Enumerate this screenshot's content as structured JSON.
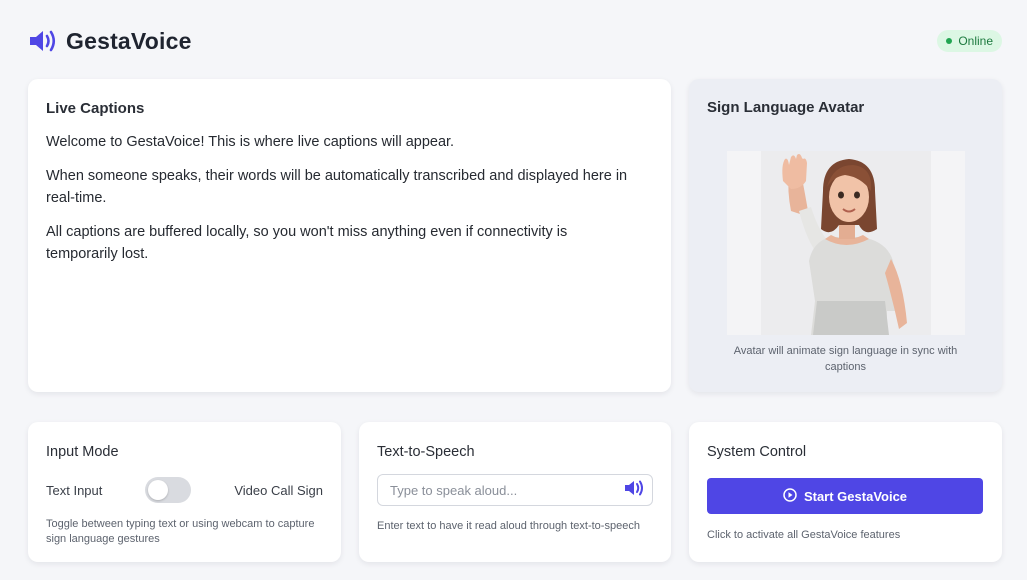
{
  "app": {
    "name": "GestaVoice",
    "brand_icon": "speaker-icon",
    "status": "Online",
    "accent_color": "#4f46e5",
    "status_color": "#22a552"
  },
  "captions": {
    "title": "Live Captions",
    "paragraphs": [
      "Welcome to GestaVoice! This is where live captions will appear.",
      "When someone speaks, their words will be automatically transcribed and displayed here in real-time.",
      "All captions are buffered locally, so you won't miss anything even if connectivity is temporarily lost."
    ]
  },
  "avatar": {
    "title": "Sign Language Avatar",
    "caption": "Avatar will animate sign language in sync with captions"
  },
  "input_mode": {
    "title": "Input Mode",
    "left_label": "Text Input",
    "right_label": "Video Call Sign",
    "toggle_on": false,
    "help": "Toggle between typing text or using webcam to capture sign language gestures"
  },
  "tts": {
    "title": "Text-to-Speech",
    "placeholder": "Type to speak aloud...",
    "value": "",
    "speak_icon": "speaker-icon",
    "help": "Enter text to have it read aloud through text-to-speech"
  },
  "system": {
    "title": "System Control",
    "button_label": "Start GestaVoice",
    "button_icon": "play-circle-icon",
    "help": "Click to activate all GestaVoice features"
  }
}
